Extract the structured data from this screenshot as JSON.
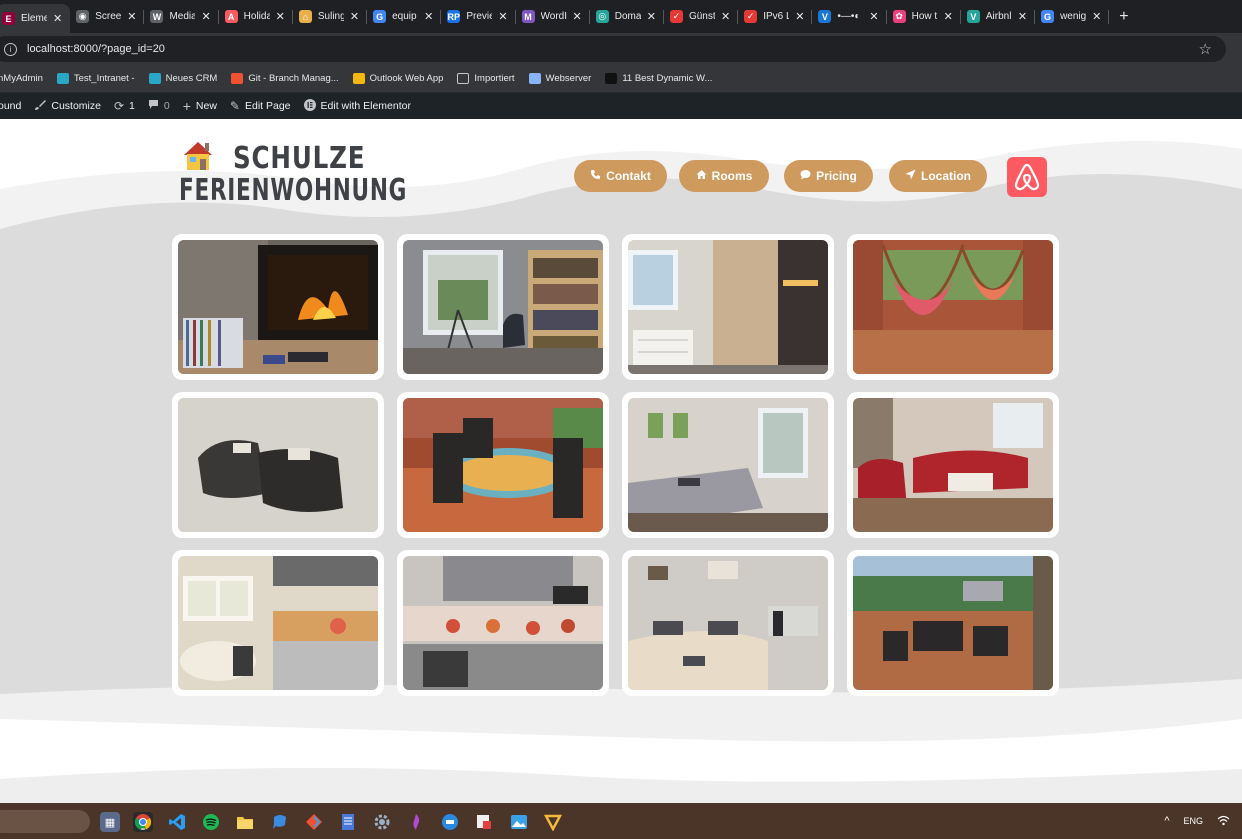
{
  "browser": {
    "tabs": [
      {
        "label": "Eleme",
        "favicon_color": "#92003b",
        "favicon_glyph": "E",
        "active": true
      },
      {
        "label": "Screen",
        "favicon_color": "#5f6368",
        "favicon_glyph": "◉",
        "active": false
      },
      {
        "label": "Media",
        "favicon_color": "#5f6368",
        "favicon_glyph": "W",
        "active": false
      },
      {
        "label": "Holida",
        "favicon_color": "#fd5a62",
        "favicon_glyph": "A",
        "active": false
      },
      {
        "label": "Suling",
        "favicon_color": "#e8b04b",
        "favicon_glyph": "⌂",
        "active": false
      },
      {
        "label": "equip",
        "favicon_color": "#4285f4",
        "favicon_glyph": "G",
        "active": false
      },
      {
        "label": "Previe",
        "favicon_color": "#1a73e8",
        "favicon_glyph": "RP",
        "active": false
      },
      {
        "label": "WordI",
        "favicon_color": "#7e57c2",
        "favicon_glyph": "M",
        "active": false
      },
      {
        "label": "Doma",
        "favicon_color": "#26a69a",
        "favicon_glyph": "◎",
        "active": false
      },
      {
        "label": "Günst",
        "favicon_color": "#e53935",
        "favicon_glyph": "✓",
        "active": false
      },
      {
        "label": "IPv6 L",
        "favicon_color": "#e53935",
        "favicon_glyph": "✓",
        "active": false
      },
      {
        "label": "•—•◐",
        "favicon_color": "#1976d2",
        "favicon_glyph": "V",
        "active": false
      },
      {
        "label": "How t",
        "favicon_color": "#ec407a",
        "favicon_glyph": "✿",
        "active": false
      },
      {
        "label": "Airbnl",
        "favicon_color": "#26a69a",
        "favicon_glyph": "V",
        "active": false
      },
      {
        "label": "wenig",
        "favicon_color": "#4285f4",
        "favicon_glyph": "G",
        "active": false
      }
    ],
    "new_tab": "+",
    "close_glyph": "✕",
    "url": "localhost:8000/?page_id=20",
    "bookmarks": [
      {
        "label": "nMyAdmin",
        "icon_color": "#6c78af"
      },
      {
        "label": "Test_Intranet -",
        "icon_color": "#2aa7c7"
      },
      {
        "label": "Neues CRM",
        "icon_color": "#2aa7c7"
      },
      {
        "label": "Git - Branch Manag...",
        "icon_color": "#f05133"
      },
      {
        "label": "Outlook Web App",
        "icon_color": "#f3b712"
      },
      {
        "label": "Importiert",
        "icon_color": "#35363a"
      },
      {
        "label": "Webserver",
        "icon_color": "#8ab4f8"
      },
      {
        "label": "11 Best Dynamic W...",
        "icon_color": "#111111"
      }
    ]
  },
  "wp_admin_bar": {
    "items": [
      {
        "label": "ound",
        "icon": ""
      },
      {
        "label": "Customize",
        "icon": "brush-icon"
      },
      {
        "label": "1",
        "icon": "updates-icon"
      },
      {
        "label": "0",
        "icon": "comments-icon"
      },
      {
        "label": "New",
        "icon": "plus-icon"
      },
      {
        "label": "Edit Page",
        "icon": "pencil-icon"
      },
      {
        "label": "Edit with Elementor",
        "icon": "elementor-icon"
      }
    ]
  },
  "site": {
    "logo_line1": "SCHULZE",
    "logo_line2": "FERIENWOHNUNG",
    "nav": [
      {
        "label": "Contakt",
        "icon": "phone-icon"
      },
      {
        "label": "Rooms",
        "icon": "house-icon"
      },
      {
        "label": "Pricing",
        "icon": "chat-icon"
      },
      {
        "label": "Location",
        "icon": "location-arrow-icon"
      }
    ],
    "accent_color": "#cf9a5e",
    "airbnb_color": "#fd5a62",
    "gallery": [
      {
        "subject": "fireplace-tv"
      },
      {
        "subject": "study-room"
      },
      {
        "subject": "bathroom-shower"
      },
      {
        "subject": "hammocks-balcony"
      },
      {
        "subject": "towels-on-bed"
      },
      {
        "subject": "patio-dining-table"
      },
      {
        "subject": "bedroom-window"
      },
      {
        "subject": "red-leather-sofa"
      },
      {
        "subject": "kitchen-window"
      },
      {
        "subject": "kitchen-oven"
      },
      {
        "subject": "bedroom-desk"
      },
      {
        "subject": "rooftop-terrace"
      }
    ]
  },
  "taskbar": {
    "tray_lang": "ENG",
    "tray_chevron": "^"
  }
}
